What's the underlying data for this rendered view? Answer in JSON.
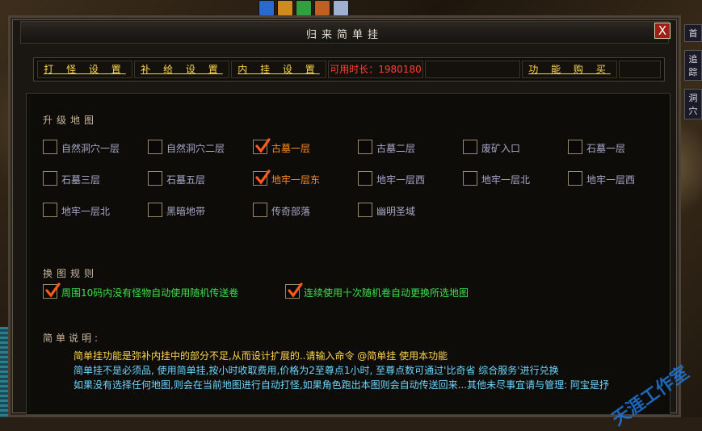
{
  "window": {
    "title": "归来简单挂",
    "close_label": "X"
  },
  "tabs": [
    {
      "label": "打 怪 设 置"
    },
    {
      "label": "补 给 设 置"
    },
    {
      "label": "内 挂 设 置"
    },
    {
      "label": "可用时长：1980180"
    },
    {
      "label": ""
    },
    {
      "label": "功 能 购 买"
    },
    {
      "label": ""
    }
  ],
  "upgrade_maps": {
    "title": "升级地图",
    "items": [
      {
        "label": "自然洞穴一层",
        "checked": false
      },
      {
        "label": "自然洞穴二层",
        "checked": false
      },
      {
        "label": "古墓一层",
        "checked": true
      },
      {
        "label": "古墓二层",
        "checked": false
      },
      {
        "label": "废矿入口",
        "checked": false
      },
      {
        "label": "石墓一层",
        "checked": false
      },
      {
        "label": "石墓三层",
        "checked": false
      },
      {
        "label": "石墓五层",
        "checked": false
      },
      {
        "label": "地牢一层东",
        "checked": true
      },
      {
        "label": "地牢一层西",
        "checked": false
      },
      {
        "label": "地牢一层北",
        "checked": false
      },
      {
        "label": "地牢一层西",
        "checked": false
      },
      {
        "label": "地牢一层北",
        "checked": false
      },
      {
        "label": "黑暗地带",
        "checked": false
      },
      {
        "label": "传奇部落",
        "checked": false
      },
      {
        "label": "幽明圣域",
        "checked": false
      }
    ]
  },
  "map_rules": {
    "title": "换图规则",
    "items": [
      {
        "label": "周围10码内没有怪物自动使用随机传送卷",
        "checked": true
      },
      {
        "label": "连续使用十次随机卷自动更换所选地图",
        "checked": true
      }
    ]
  },
  "description": {
    "title": "简单说明:",
    "lines": [
      "简单挂功能是弥补内挂中的部分不足,从而设计扩展的..请输入命令 @简单挂 使用本功能",
      "简单挂不是必须品, 使用简单挂,按小时收取费用,价格为2至尊点1小时, 至尊点数可通过'比奇省 综合服务'进行兑换",
      "如果没有选择任何地图,则会在当前地图进行自动打怪,如果角色跑出本图则会自动传送回来...其他未尽事宜请与管理: 阿宝是抒"
    ]
  },
  "background": {
    "right_labels": [
      "首",
      "追踪",
      "洞穴"
    ],
    "watermark": "天涯工作室"
  },
  "colors": {
    "tab_yellow": "#ffd54a",
    "tab_red": "#ff4030",
    "map_active": "#ff8a1a",
    "map_inactive": "#a8a8c8",
    "rule_green": "#3ce04a",
    "check_orange": "#ff5a1a",
    "desc_yellow": "#ffd54a",
    "desc_cyan": "#6ad6ff"
  }
}
